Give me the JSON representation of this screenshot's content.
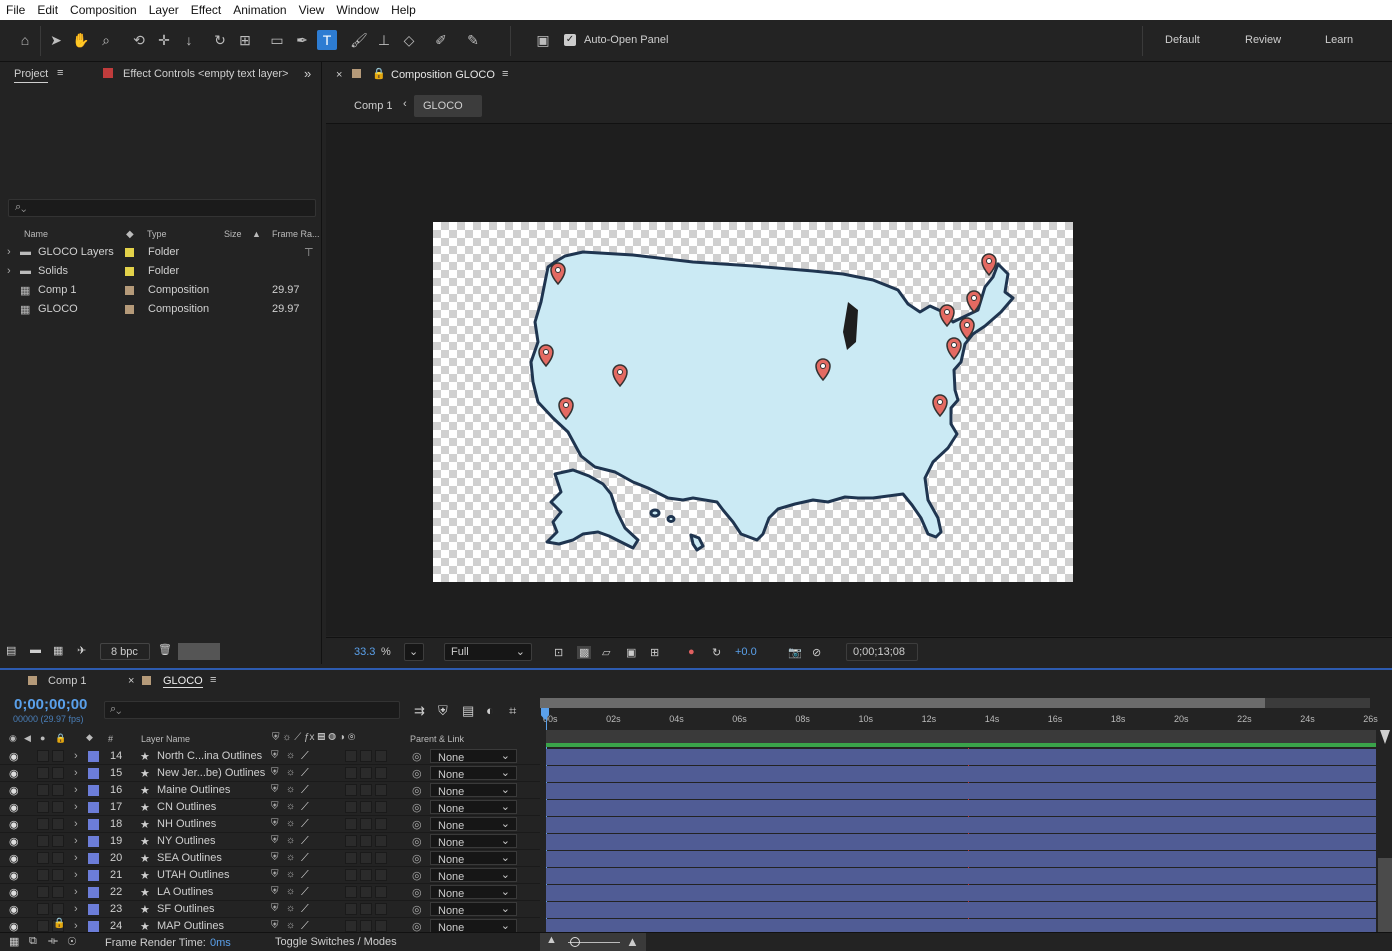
{
  "menu": [
    "File",
    "Edit",
    "Composition",
    "Layer",
    "Effect",
    "Animation",
    "View",
    "Window",
    "Help"
  ],
  "toolbar": {
    "auto_open": "Auto-Open Panel",
    "workspaces": [
      "Default",
      "Review",
      "Learn"
    ]
  },
  "project": {
    "tab": "Project",
    "effect_tab": "Effect Controls <empty text layer>",
    "cols": {
      "name": "Name",
      "type": "Type",
      "size": "Size",
      "frame": "Frame Ra..."
    },
    "items": [
      {
        "name": "GLOCO Layers",
        "type": "Folder",
        "fps": "",
        "color": "#e3d24a"
      },
      {
        "name": "Solids",
        "type": "Folder",
        "fps": "",
        "color": "#e3d24a"
      },
      {
        "name": "Comp 1",
        "type": "Composition",
        "fps": "29.97",
        "color": "#b59a79"
      },
      {
        "name": "GLOCO",
        "type": "Composition",
        "fps": "29.97",
        "color": "#b59a79"
      }
    ],
    "bpc": "8 bpc"
  },
  "comp": {
    "tab": "Composition GLOCO",
    "crumbs": [
      "Comp 1",
      "GLOCO"
    ]
  },
  "viewbar": {
    "zoom": "33.3",
    "pct": "%",
    "res": "Full",
    "exposure": "+0.0",
    "timecode": "0;00;13;08"
  },
  "timeline": {
    "tabs": [
      "Comp 1",
      "GLOCO"
    ],
    "time": "0;00;00;00",
    "fps": "00000 (29.97 fps)",
    "layer_name_hdr": "Layer Name",
    "parent_hdr": "Parent & Link",
    "num_hdr": "#",
    "ruler": [
      "00s",
      "02s",
      "04s",
      "06s",
      "08s",
      "10s",
      "12s",
      "14s",
      "16s",
      "18s",
      "20s",
      "22s",
      "24s",
      "26s"
    ],
    "footer_render": "Frame Render Time:",
    "footer_ms": "0ms",
    "footer_toggle": "Toggle Switches / Modes",
    "layers": [
      {
        "n": "14",
        "name": "North C...ina Outlines",
        "parent": "None"
      },
      {
        "n": "15",
        "name": "New Jer...be) Outlines",
        "parent": "None"
      },
      {
        "n": "16",
        "name": "Maine Outlines",
        "parent": "None"
      },
      {
        "n": "17",
        "name": "CN Outlines",
        "parent": "None"
      },
      {
        "n": "18",
        "name": "NH Outlines",
        "parent": "None"
      },
      {
        "n": "19",
        "name": "NY Outlines",
        "parent": "None"
      },
      {
        "n": "20",
        "name": "SEA Outlines",
        "parent": "None"
      },
      {
        "n": "21",
        "name": "UTAH Outlines",
        "parent": "None"
      },
      {
        "n": "22",
        "name": "LA Outlines",
        "parent": "None"
      },
      {
        "n": "23",
        "name": "SF Outlines",
        "parent": "None"
      },
      {
        "n": "24",
        "name": "MAP Outlines",
        "parent": "None"
      }
    ]
  },
  "colors": {
    "accent": "#2d7cd2",
    "track": "#505c95",
    "label": "#6c7dd8",
    "map_fill": "#cbeaf4",
    "pin": "#e46a62"
  }
}
